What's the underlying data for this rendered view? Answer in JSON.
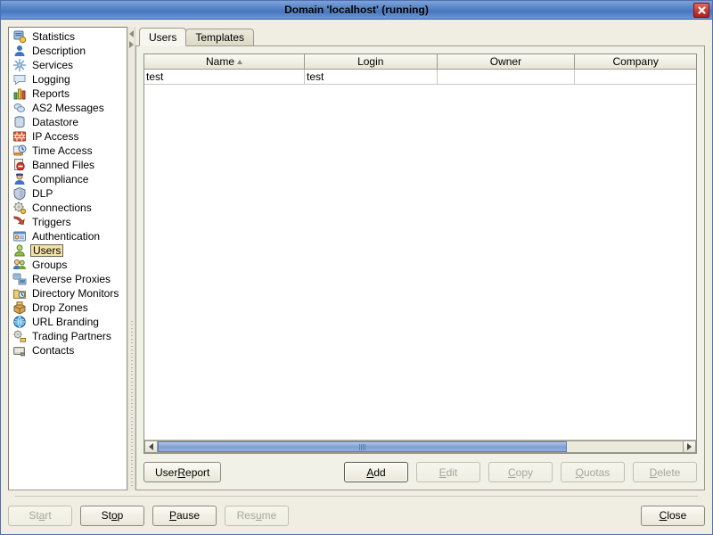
{
  "window": {
    "title": "Domain 'localhost' (running)",
    "close_icon": "close-icon"
  },
  "sidebar": {
    "items": [
      {
        "label": "Statistics",
        "icon": "statistics-icon"
      },
      {
        "label": "Description",
        "icon": "description-icon"
      },
      {
        "label": "Services",
        "icon": "services-icon"
      },
      {
        "label": "Logging",
        "icon": "logging-icon"
      },
      {
        "label": "Reports",
        "icon": "reports-icon"
      },
      {
        "label": "AS2 Messages",
        "icon": "as2-messages-icon"
      },
      {
        "label": "Datastore",
        "icon": "datastore-icon"
      },
      {
        "label": "IP Access",
        "icon": "ip-access-icon"
      },
      {
        "label": "Time Access",
        "icon": "time-access-icon"
      },
      {
        "label": "Banned Files",
        "icon": "banned-files-icon"
      },
      {
        "label": "Compliance",
        "icon": "compliance-icon"
      },
      {
        "label": "DLP",
        "icon": "dlp-icon"
      },
      {
        "label": "Connections",
        "icon": "connections-icon"
      },
      {
        "label": "Triggers",
        "icon": "triggers-icon"
      },
      {
        "label": "Authentication",
        "icon": "authentication-icon"
      },
      {
        "label": "Users",
        "icon": "users-icon",
        "selected": true
      },
      {
        "label": "Groups",
        "icon": "groups-icon"
      },
      {
        "label": "Reverse Proxies",
        "icon": "reverse-proxies-icon"
      },
      {
        "label": "Directory Monitors",
        "icon": "directory-monitors-icon"
      },
      {
        "label": "Drop Zones",
        "icon": "drop-zones-icon"
      },
      {
        "label": "URL Branding",
        "icon": "url-branding-icon"
      },
      {
        "label": "Trading Partners",
        "icon": "trading-partners-icon"
      },
      {
        "label": "Contacts",
        "icon": "contacts-icon"
      }
    ]
  },
  "tabs": [
    {
      "label": "Users",
      "active": true
    },
    {
      "label": "Templates",
      "active": false
    }
  ],
  "table": {
    "columns": [
      {
        "label": "Name",
        "width": "29%",
        "sorted": "asc"
      },
      {
        "label": "Login",
        "width": "24%"
      },
      {
        "label": "Owner",
        "width": "25%"
      },
      {
        "label": "Company",
        "width": "22%"
      }
    ],
    "rows": [
      {
        "name": "test",
        "login": "test",
        "owner": "",
        "company": ""
      }
    ]
  },
  "scrollbar": {
    "thumb_percent": "78%",
    "left_icon": "scroll-left-arrow-icon",
    "right_icon": "scroll-right-arrow-icon"
  },
  "action_buttons": {
    "user_report": {
      "pre": "User ",
      "mn": "R",
      "post": "eport",
      "disabled": false
    },
    "add": {
      "pre": "",
      "mn": "A",
      "post": "dd",
      "disabled": false,
      "default": true
    },
    "edit": {
      "pre": "",
      "mn": "E",
      "post": "dit",
      "disabled": true
    },
    "copy": {
      "pre": "",
      "mn": "C",
      "post": "opy",
      "disabled": true
    },
    "quotas": {
      "pre": "",
      "mn": "Q",
      "post": "uotas",
      "disabled": true
    },
    "delete": {
      "pre": "",
      "mn": "D",
      "post": "elete",
      "disabled": true
    }
  },
  "bottom_buttons": {
    "start": {
      "pre": "St",
      "mn": "a",
      "post": "rt",
      "disabled": true
    },
    "stop": {
      "pre": "St",
      "mn": "o",
      "post": "p",
      "disabled": false
    },
    "pause": {
      "pre": "",
      "mn": "P",
      "post": "ause",
      "disabled": false
    },
    "resume": {
      "pre": "Res",
      "mn": "u",
      "post": "me",
      "disabled": true
    },
    "close": {
      "pre": "",
      "mn": "C",
      "post": "lose",
      "disabled": false
    }
  },
  "colors": {
    "titlebar": "#5c88c8",
    "close_button": "#c6352b",
    "dialog_bg": "#f0eee2",
    "selection_highlight": "#f4e3a8",
    "scroll_thumb": "#7e9fd4"
  }
}
